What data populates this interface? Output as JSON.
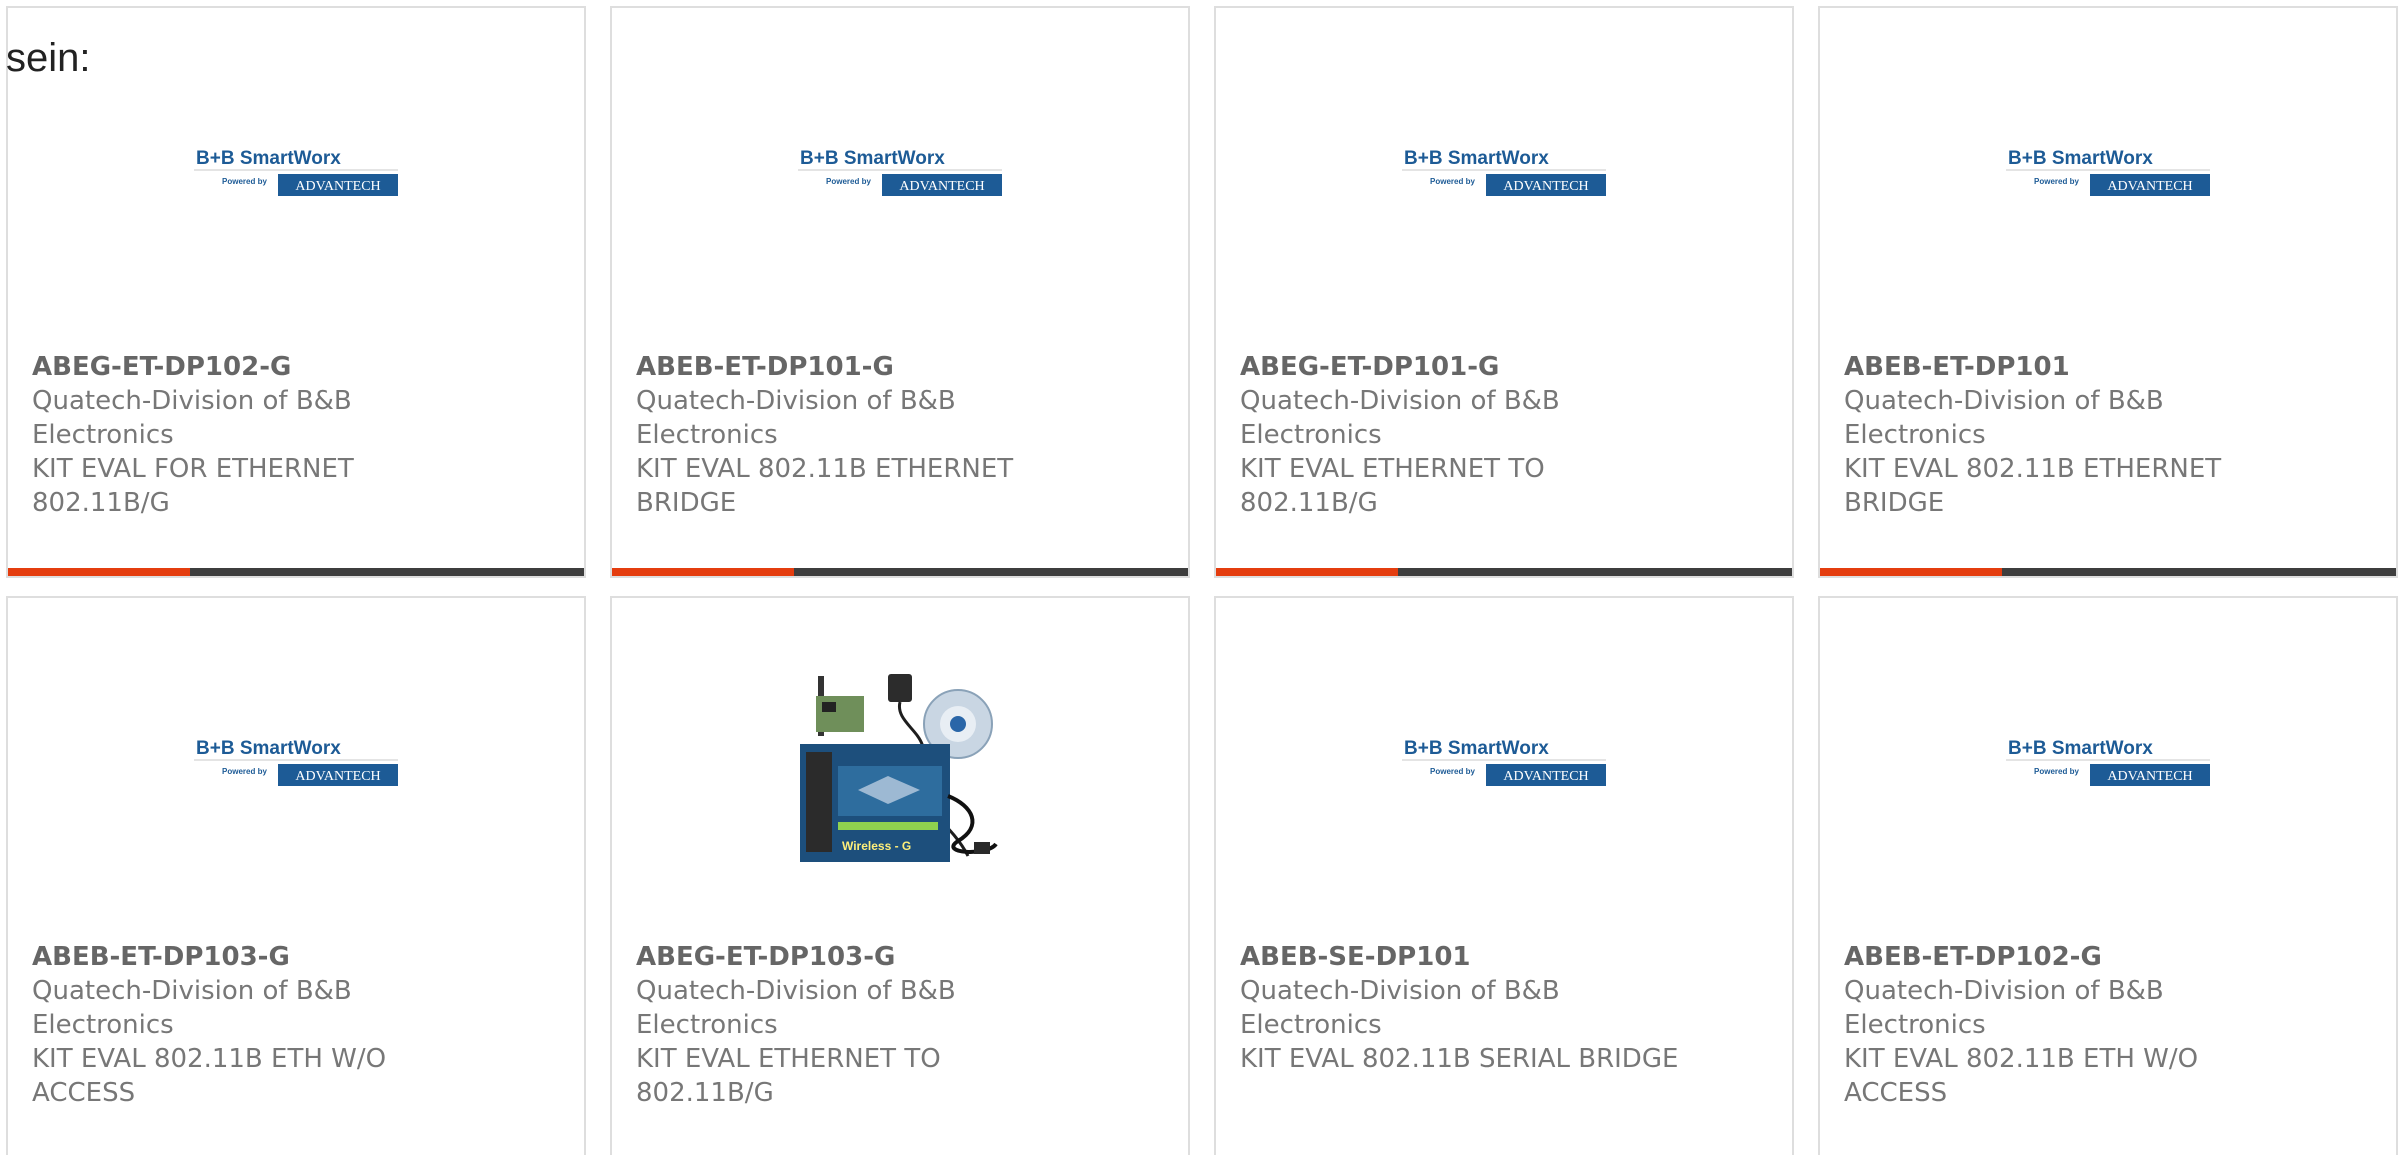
{
  "intro_text": "sein:",
  "colors": {
    "accent": "#e43d0f",
    "bar_dark": "#3e3e3e",
    "logo_blue": "#1d5b96",
    "text_gray": "#777777"
  },
  "logo": {
    "brand_line": "B+B SmartWorx",
    "powered_by": "Powered by",
    "partner": "ADVANTECH"
  },
  "products": [
    {
      "part_number": "ABEG-ET-DP102-G",
      "manufacturer": "Quatech-Division of B&B Electronics",
      "description": "KIT EVAL FOR ETHERNET 802.11B/G",
      "image": "bb-smartworx-logo"
    },
    {
      "part_number": "ABEB-ET-DP101-G",
      "manufacturer": "Quatech-Division of B&B Electronics",
      "description": "KIT EVAL 802.11B ETHERNET BRIDGE",
      "image": "bb-smartworx-logo"
    },
    {
      "part_number": "ABEG-ET-DP101-G",
      "manufacturer": "Quatech-Division of B&B Electronics",
      "description": "KIT EVAL ETHERNET TO 802.11B/G",
      "image": "bb-smartworx-logo"
    },
    {
      "part_number": "ABEB-ET-DP101",
      "manufacturer": "Quatech-Division of B&B Electronics",
      "description": "KIT EVAL 802.11B ETHERNET BRIDGE",
      "image": "bb-smartworx-logo"
    },
    {
      "part_number": "ABEB-ET-DP103-G",
      "manufacturer": "Quatech-Division of B&B Electronics",
      "description": "KIT EVAL 802.11B ETH W/O ACCESS",
      "image": "bb-smartworx-logo"
    },
    {
      "part_number": "ABEG-ET-DP103-G",
      "manufacturer": "Quatech-Division of B&B Electronics",
      "description": "KIT EVAL ETHERNET TO 802.11B/G",
      "image": "product-photo-kit",
      "photo_box_text": "Wireless - G"
    },
    {
      "part_number": "ABEB-SE-DP101",
      "manufacturer": "Quatech-Division of B&B Electronics",
      "description": "KIT EVAL 802.11B SERIAL BRIDGE",
      "image": "bb-smartworx-logo"
    },
    {
      "part_number": "ABEB-ET-DP102-G",
      "manufacturer": "Quatech-Division of B&B Electronics",
      "description": "KIT EVAL 802.11B ETH W/O ACCESS",
      "image": "bb-smartworx-logo"
    }
  ]
}
